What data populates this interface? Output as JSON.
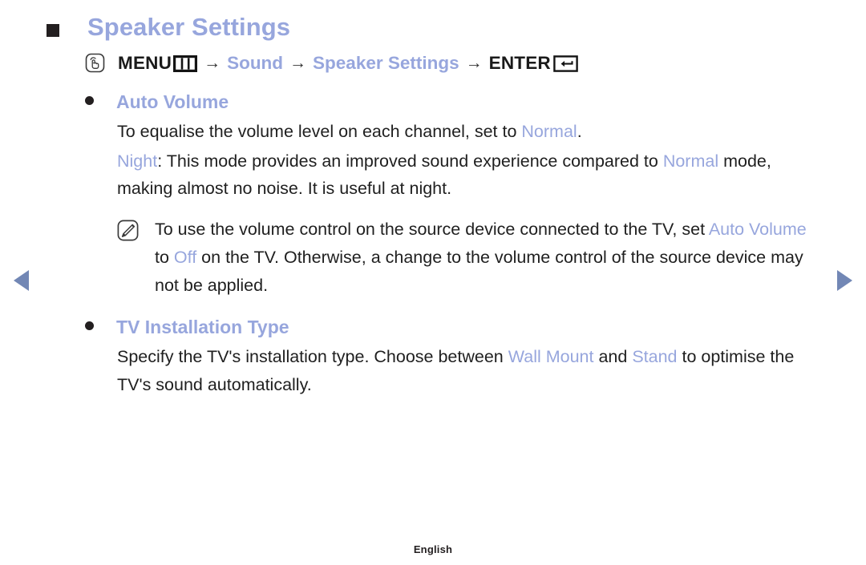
{
  "colors": {
    "accent_blue": "#97a6dd",
    "arrow_blue": "#7287b5",
    "text_dark": "#1f1f1f",
    "bullet_dark": "#231f20",
    "background": "#ffffff"
  },
  "header": {
    "title": "Speaker Settings",
    "square_bullet": "square-bullet"
  },
  "menu_path": {
    "touch_icon": "touch-press-icon",
    "menu_label": "MENU",
    "menu_key_icon": "menu-key-icon",
    "arrow1": "→",
    "item1": "Sound",
    "arrow2": "→",
    "item2": "Speaker Settings",
    "arrow3": "→",
    "enter_label": "ENTER",
    "enter_key_icon": "enter-key-icon"
  },
  "sections": [
    {
      "id": "auto-volume",
      "label": "Auto Volume",
      "paragraphs": [
        {
          "id": "auto-volume-desc",
          "runs": [
            {
              "t": "To equalise the volume level on each channel, set to ",
              "hl": false
            },
            {
              "t": "Normal",
              "hl": true
            },
            {
              "t": ".",
              "hl": false
            }
          ]
        },
        {
          "id": "night-mode-desc",
          "runs": [
            {
              "t": "Night",
              "hl": true
            },
            {
              "t": ": This mode provides an improved sound experience compared to ",
              "hl": false
            },
            {
              "t": "Normal",
              "hl": true
            },
            {
              "t": " mode, making almost no noise. It is useful at night.",
              "hl": false
            }
          ]
        }
      ],
      "note": {
        "icon": "note-pencil-icon",
        "runs": [
          {
            "t": "To use the volume control on the source device connected to the TV, set ",
            "hl": false
          },
          {
            "t": "Auto Volume",
            "hl": true
          },
          {
            "t": " to ",
            "hl": false
          },
          {
            "t": "Off",
            "hl": true
          },
          {
            "t": " on the TV. Otherwise, a change to the volume control of the source device may not be applied.",
            "hl": false
          }
        ]
      }
    },
    {
      "id": "tv-installation-type",
      "label": "TV Installation Type",
      "paragraphs": [
        {
          "id": "tv-installation-desc",
          "runs": [
            {
              "t": "Specify the TV's installation type. Choose between ",
              "hl": false
            },
            {
              "t": "Wall Mount",
              "hl": true
            },
            {
              "t": " and ",
              "hl": false
            },
            {
              "t": "Stand",
              "hl": true
            },
            {
              "t": " to optimise the TV's sound automatically.",
              "hl": false
            }
          ]
        }
      ],
      "note": null
    }
  ],
  "navigation": {
    "prev_icon": "previous-page-arrow",
    "next_icon": "next-page-arrow"
  },
  "footer": {
    "language": "English"
  }
}
